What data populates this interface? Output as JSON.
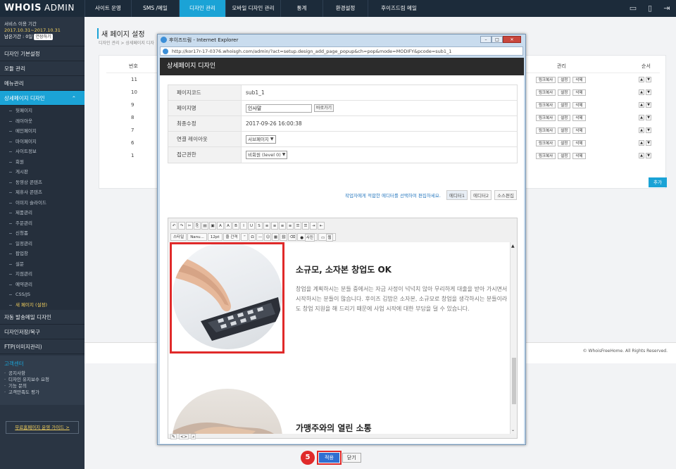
{
  "header": {
    "logo": "WHOIS",
    "admin": "ADMIN",
    "nav": [
      "사이트 운영",
      "SMS /메일",
      "디자인 관리",
      "모바일 디자인 관리",
      "통계",
      "환경설정",
      "후이즈드림 메일"
    ],
    "active_nav": 2
  },
  "sidebar": {
    "service_label": "서비스 이용 기간",
    "dates": "2017.10.31~2017.10.31",
    "remain": "남은기간 : 0일",
    "extend": "연장하기",
    "menu_top": [
      "디자인 기본설정",
      "모듈 관리",
      "메뉴관리"
    ],
    "menu_active": "상세페이지 디자인",
    "sub": [
      "헛페이지",
      "레이아웃",
      "메인페이지",
      "마이페이지",
      "사이트정보",
      "회원",
      "게시판",
      "동영상 콘텐츠",
      "제휴사 콘텐츠",
      "이미지 슬라이드",
      "제품관리",
      "주문관리",
      "신청폼",
      "일정관리",
      "팝업창",
      "설문",
      "지점관리",
      "예약관리",
      "CSS/JS",
      "새 페이지 (설정)"
    ],
    "menu_bottom": [
      "자동 발송메일 디자인",
      "디자인저장/복구",
      "FTP(이미지관리)"
    ],
    "cs_title": "고객센터",
    "cs_items": [
      "공지사항",
      "디자인 유지보수 요청",
      "기능 문의",
      "고객만족도 평가"
    ],
    "guide": "무료홈페이지 운영 가이드 >"
  },
  "main": {
    "title": "새 페이지 설정",
    "crumb": "디자인 관리 > 상세페이지 디자",
    "col_num": "번호",
    "col_manage": "관리",
    "col_order": "순서",
    "rows": [
      "11",
      "10",
      "9",
      "8",
      "7",
      "6",
      "1"
    ],
    "row_btns": [
      "링크복사",
      "설정",
      "삭제"
    ],
    "add": "추가",
    "copyright": "© WhoisFreeHome. All Rights Reserved."
  },
  "popup": {
    "window_title": "후이즈드림 - Internet Explorer",
    "url": "http://kor17r-17-0376.whoisgh.com/admin/?act=setup.design_add_page_popup&ch=pop&mode=MODIFY&pcode=sub1_1",
    "heading": "상세페이지 디자인",
    "fields": {
      "code_label": "페이지코드",
      "code": "sub1_1",
      "name_label": "페이지명",
      "name": "인사말",
      "change": "바로가기",
      "updated_label": "최종수정",
      "updated": "2017-09-26 16:00:38",
      "layout_label": "연결 레이아웃",
      "layout": "서브페이지",
      "access_label": "접근권한",
      "access": "비회원 (level 0)"
    },
    "hint": "작업자에게 적합한 에디터를 선택하여 편집하세요.",
    "tabs": [
      "에디터1",
      "에디터2",
      "소스편집"
    ],
    "toolbar2": [
      "스타일",
      "Nanu...",
      "12pt",
      "줄 간격",
      "사진",
      "웹"
    ],
    "content": {
      "h1": "소규모, 소자본 창업도 OK",
      "para": "창업을 계획하시는 분들 중에서는 자금 사정이 넉넉치 않아 무리하게 대출을 받아 가시면서 시작하시는 분들이 많습니다. 후이즈 김밥은 소자본, 소규모로 창업을 생각하시는 분들이라도 창업 지원을 해 드리기 때문에 사업 시작에 대한 부담을 덜 수 있습니다.",
      "h2": "가맹주와의 열린 소통"
    },
    "step": "5",
    "apply": "적용",
    "close": "닫기"
  }
}
